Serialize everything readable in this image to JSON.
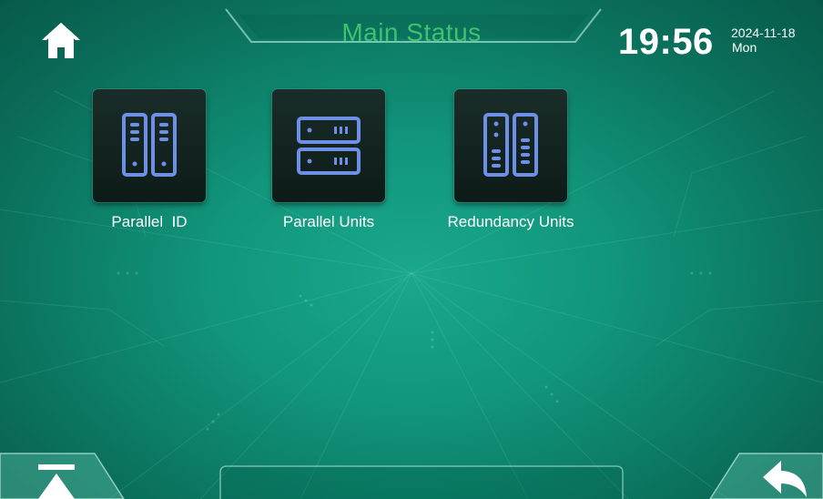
{
  "header": {
    "title": "Main Status",
    "home_icon": "home-icon",
    "time": "19:56",
    "date": "2024-11-18",
    "day": "Mon"
  },
  "tiles": [
    {
      "label": "Parallel  ID",
      "icon": "parallel-id-icon"
    },
    {
      "label": "Parallel Units",
      "icon": "parallel-units-icon"
    },
    {
      "label": "Redundancy Units",
      "icon": "redundancy-units-icon"
    }
  ],
  "footer": {
    "scroll_top_icon": "scroll-to-top-icon",
    "back_icon": "back-arrow-icon",
    "message": ""
  },
  "colors": {
    "background": "#11957b",
    "title": "#3fc26e",
    "icon_stroke": "#6d8fe6",
    "tile_bg": "#10201d",
    "text": "#ffffff"
  }
}
